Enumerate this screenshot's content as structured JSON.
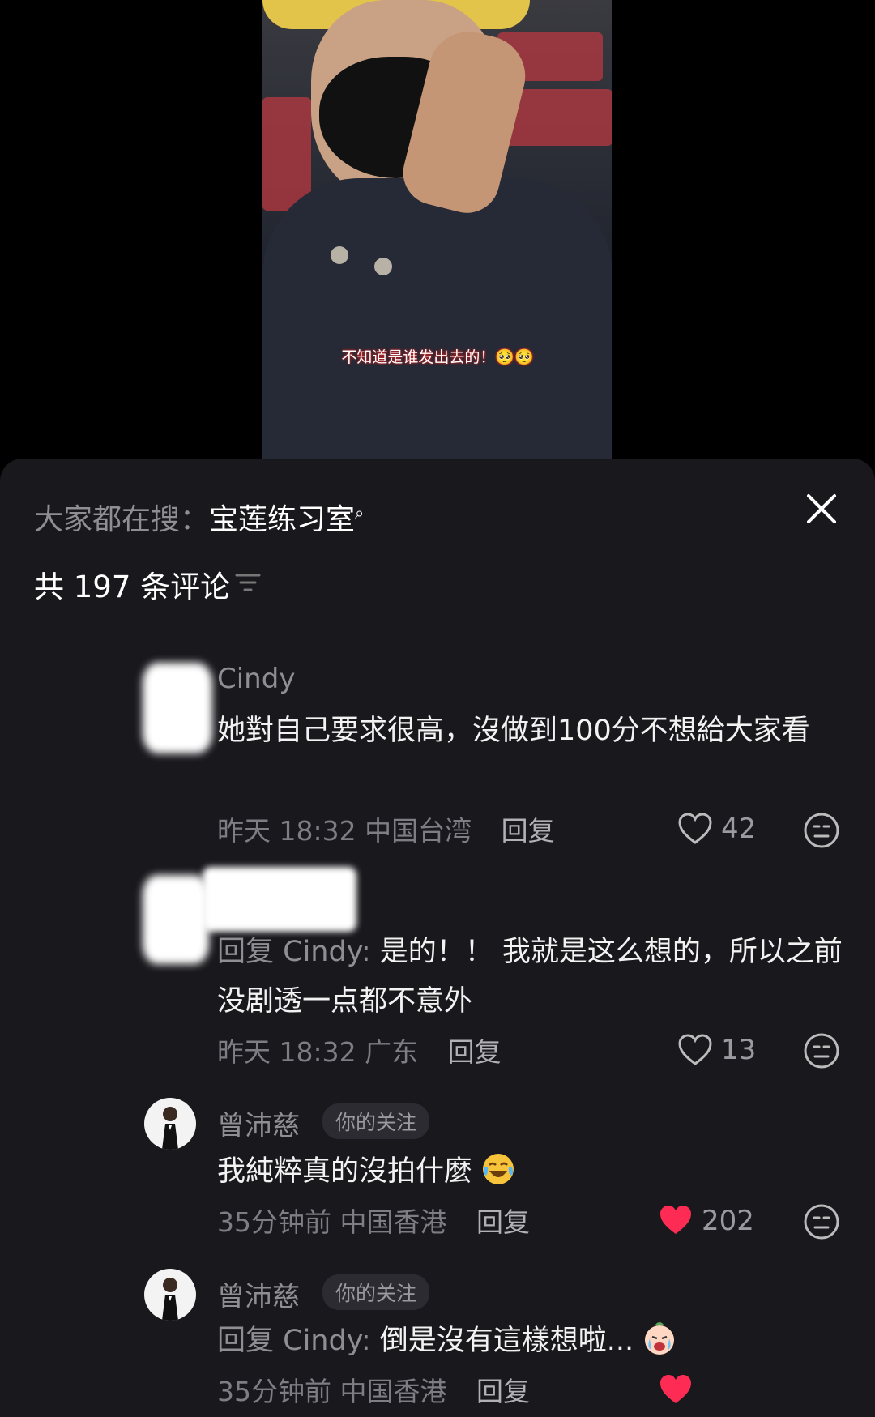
{
  "video": {
    "caption": "不知道是谁发出去的！🥺🥺"
  },
  "header": {
    "search_prefix": "大家都在搜：",
    "search_term": "宝莲练习室",
    "comment_count": "共 197 条评论"
  },
  "comments": [
    {
      "username": "Cindy",
      "text": "她對自己要求很高，沒做到100分不想給大家看",
      "time": "昨天 18:32",
      "location": "中国台湾",
      "reply_label": "回复",
      "likes": "42",
      "liked": false
    },
    {
      "username": "",
      "reply_prefix": "回复 Cindy:",
      "text": " 是的！！ 我就是这么想的，所以之前没剧透一点都不意外",
      "time": "昨天 18:32",
      "location": "广东",
      "reply_label": "回复",
      "likes": "13",
      "liked": false
    },
    {
      "username": "曾沛慈",
      "tag": "你的关注",
      "text": "我純粹真的沒拍什麼",
      "emoji": "tears-of-joy-emoji",
      "time": "35分钟前",
      "location": "中国香港",
      "reply_label": "回复",
      "likes": "202",
      "liked": true
    },
    {
      "username": "曾沛慈",
      "tag": "你的关注",
      "reply_prefix": "回复 Cindy:",
      "text": " 倒是沒有這樣想啦...",
      "emoji": "crying-emoji",
      "time": "35分钟前",
      "location": "中国香港",
      "reply_label": "回复",
      "liked": true
    }
  ],
  "colors": {
    "panel_bg": "#19181d",
    "like_red": "#fe2c55",
    "muted_text": "#8e8e93"
  }
}
